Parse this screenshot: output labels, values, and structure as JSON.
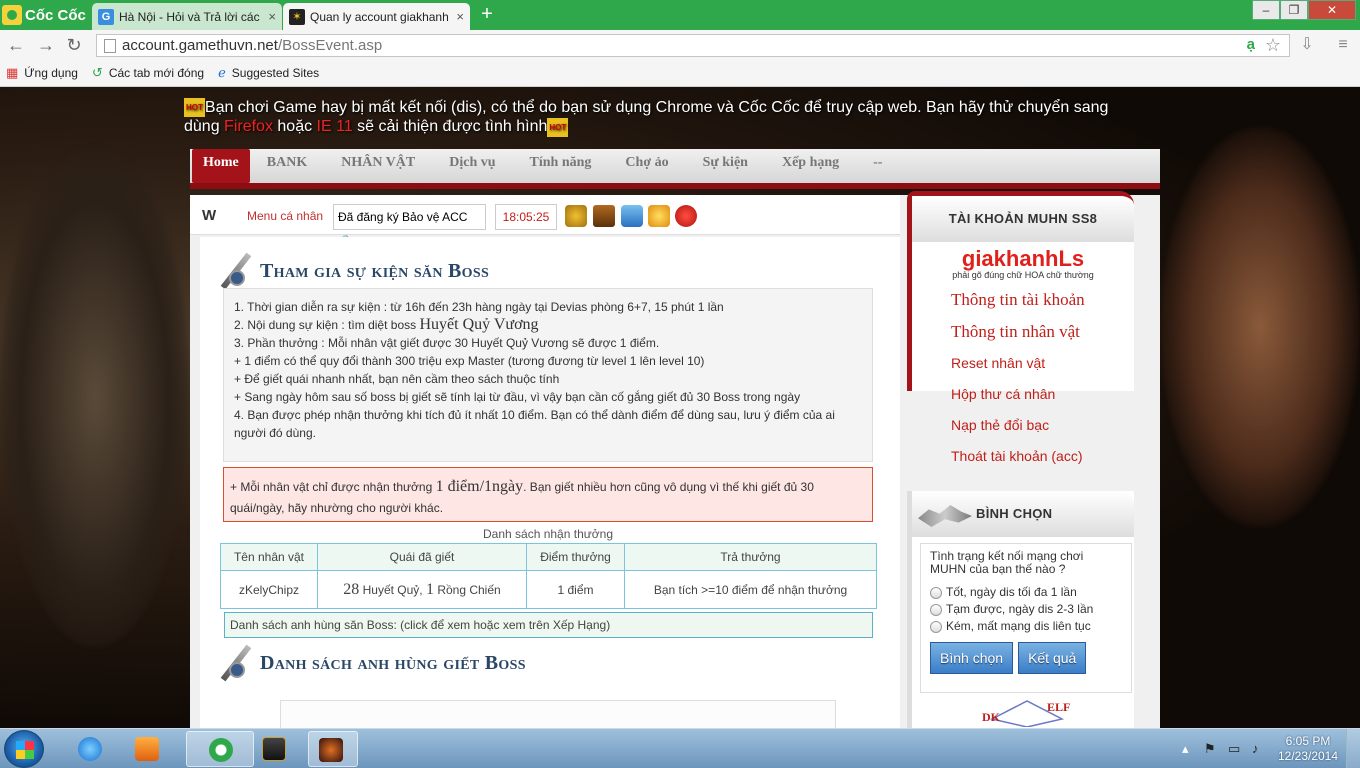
{
  "browser": {
    "brand": "Cốc Cốc",
    "tabs": [
      {
        "title": "Hà Nội - Hỏi và Trả lời các",
        "fav": "G"
      },
      {
        "title": "Quan ly account giakhanh",
        "fav": "✶"
      }
    ],
    "url_host": "account.gamethuvn.net",
    "url_path": "/BossEvent.asp",
    "bookmarks": [
      {
        "label": "Ứng dụng",
        "icon": "apps-grid-icon"
      },
      {
        "label": "Các tab mới đóng",
        "icon": "history-icon"
      },
      {
        "label": "Suggested Sites",
        "icon": "ie-icon"
      }
    ]
  },
  "notice": {
    "text1": "Bạn chơi Game hay bị mất kết nối (dis), có thể do bạn sử dụng Chrome và Cốc Cốc để truy cập web. Bạn hãy thử chuyển sang dùng ",
    "firefox": "Firefox",
    "or": " hoặc ",
    "ie": "IE 11",
    "text2": " sẽ cải thiện được tình hình",
    "badge": "HOT"
  },
  "menu": [
    "Home",
    "BANK",
    "NHÂN VẬT",
    "Dịch vụ",
    "Tính năng",
    "Chợ ảo",
    "Sự kiện",
    "Xếp hạng",
    "--"
  ],
  "toolbar": {
    "logo": "W",
    "menu_label": "Menu cá nhân",
    "protect": "Đã đăng ký Bảo vệ ACC",
    "time": "18:05:25"
  },
  "event": {
    "title": "Tham gia sự kiện săn Boss",
    "line1": "1. Thời gian diễn ra sự kiện : từ 16h đến 23h hàng ngày tại Devias phòng 6+7, 15 phút 1 lần",
    "line2_pre": "2. Nội dung sự kiện : tìm diệt boss ",
    "line2_boss": "Huyết Quỷ Vương",
    "line3": "3. Phần thưởng : Mỗi nhân vật giết được 30 Huyết Quỷ Vương sẽ được 1 điểm.",
    "line4": "+ 1 điểm có thể quy đổi thành 300 triệu exp Master (tương đương từ level 1 lên level 10)",
    "line5": "+ Để giết quái nhanh nhất, bạn nên cầm theo sách thuộc tính",
    "line6": "+ Sang ngày hôm sau số boss bị giết sẽ tính lại từ đầu, vì vậy bạn cần cố gắng giết đủ 30 Boss trong ngày",
    "line7": "4. Bạn được phép nhận thưởng khi tích đủ ít nhất 10 điểm. Bạn có thể dành điểm để dùng sau, lưu ý điểm của ai người đó dùng.",
    "warn_pre": "+ Mỗi nhân vật chỉ được nhận thưởng ",
    "warn_big": "1 điểm/1ngày",
    "warn_post": ". Bạn giết nhiều hơn cũng vô dụng vì thế khi giết đủ 30 quái/ngày, hãy nhường cho người khác."
  },
  "reward_table": {
    "caption": "Danh sách nhận thưởng",
    "headers": [
      "Tên nhân vật",
      "Quái đã giết",
      "Điểm thưởng",
      "Trả thưởng"
    ],
    "row": {
      "name": "zKelyChipz",
      "kill_a": "28",
      "kill_a_label": " Huyết Quỷ, ",
      "kill_b": "1",
      "kill_b_label": " Rồng Chiến",
      "points": "1 điểm",
      "reward": "Bạn tích >=10 điểm để nhận thưởng"
    }
  },
  "hero_link": "Danh sách anh hùng săn Boss: (click để xem hoặc xem trên Xếp Hạng)",
  "heroes_title": "Danh sách anh hùng giết Boss",
  "account": {
    "header": "TÀI KHOẢN MUHN SS8",
    "username": "giakhanhLs",
    "note": "phải gõ đúng chữ HOA chữ thường",
    "links": [
      "Thông tin tài khoản",
      "Thông tin nhân vật",
      "Reset nhân vật",
      "Hộp thư cá nhân",
      "Nạp thẻ đổi bạc",
      "Thoát tài khoản (acc)"
    ]
  },
  "poll": {
    "header": "BÌNH CHỌN",
    "question": "Tình trạng kết nối mạng chơi MUHN của bạn thế nào ?",
    "options": [
      "Tốt, ngày dis tối đa 1 lần",
      "Tạm được, ngày dis 2-3 lần",
      "Kém, mất mạng dis liên tục"
    ],
    "vote": "Bình chọn",
    "result": "Kết quả",
    "diagram_labels": [
      "DK",
      "ELF"
    ]
  },
  "taskbar": {
    "time": "6:05 PM",
    "date": "12/23/2014"
  },
  "colors": {
    "brand_green": "#2fa84b",
    "menu_red": "#a4131a",
    "link_red": "#c0201a",
    "title_blue": "#2b4766"
  }
}
